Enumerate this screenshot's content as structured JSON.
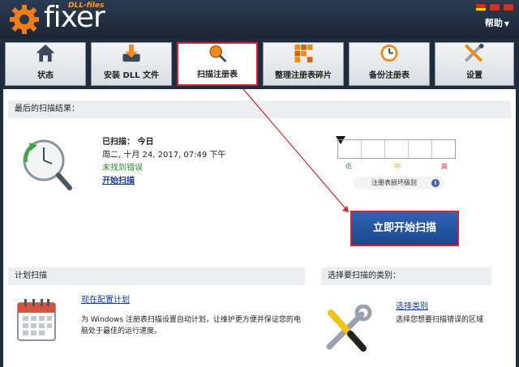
{
  "app": {
    "logo_text": "fixer",
    "logo_small": "DLL-files"
  },
  "menu": {
    "help": "帮助"
  },
  "tabs": [
    {
      "label": "状态",
      "icon": "home-icon"
    },
    {
      "label": "安装 DLL 文件",
      "icon": "install-icon"
    },
    {
      "label": "扫描注册表",
      "icon": "scan-icon"
    },
    {
      "label": "整理注册表碎片",
      "icon": "defrag-icon"
    },
    {
      "label": "备份注册表",
      "icon": "backup-icon"
    },
    {
      "label": "设置",
      "icon": "settings-icon"
    }
  ],
  "last_scan": {
    "header": "最后的扫描结果：",
    "scanned_label": "已扫描：  今日",
    "datetime": "周二, 十月  24, 2017, 07:49 下午",
    "status": "未找到错误",
    "start_link": "开始扫描"
  },
  "severity": {
    "low_label": "低",
    "mid_label": "中",
    "high_label": "高",
    "legend": "注册表损坏级别",
    "level": 0
  },
  "scan_now_button": "立即开始扫描",
  "schedule": {
    "header": "计划扫描",
    "link": "现在配置计划",
    "desc": "为 Windows 注册表扫描设置自动计划，让维护更方便并保证您的电脑处于最佳的运行速度。"
  },
  "categories": {
    "header": "选择要扫描的类别：",
    "link": "选择类别",
    "desc": "选择您想要扫描错误的区域"
  },
  "colors": {
    "accent_red": "#d6232f",
    "button_blue": "#2f63b3",
    "brand_orange": "#f39c35"
  }
}
